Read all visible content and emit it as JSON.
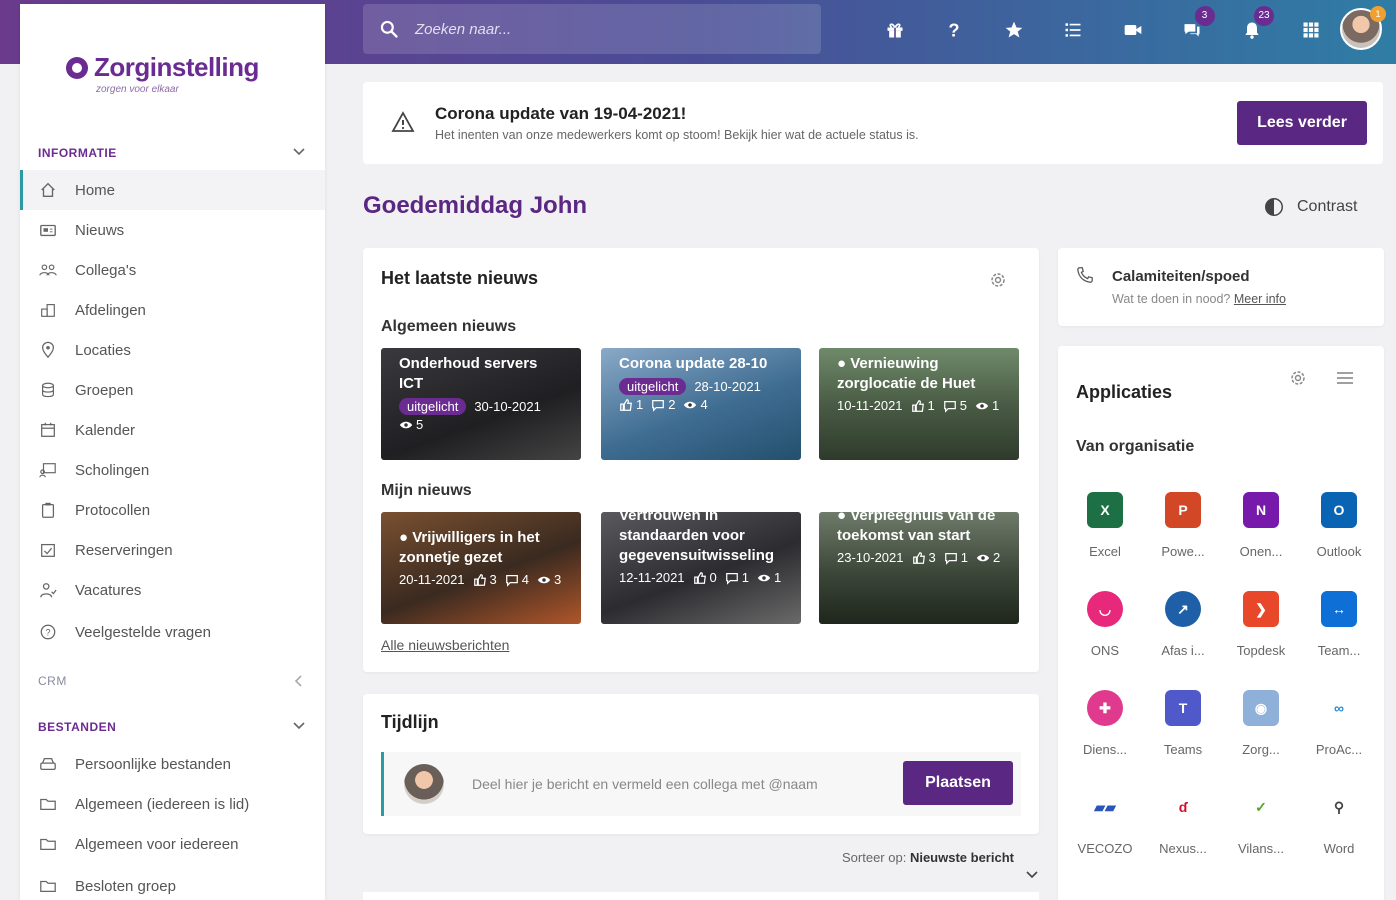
{
  "header": {
    "search_placeholder": "Zoeken naar...",
    "icons": [
      {
        "name": "gift-icon",
        "badge": ""
      },
      {
        "name": "help-icon",
        "badge": ""
      },
      {
        "name": "star-icon",
        "badge": ""
      },
      {
        "name": "list-icon",
        "badge": ""
      },
      {
        "name": "video-icon",
        "badge": ""
      },
      {
        "name": "chat-icon",
        "badge": "3"
      },
      {
        "name": "bell-icon",
        "badge": "23"
      },
      {
        "name": "grid-icon",
        "badge": ""
      }
    ],
    "avatar_badge": "1"
  },
  "sidebar": {
    "logo": {
      "name": "Zorginstelling",
      "tagline": "zorgen voor elkaar"
    },
    "sections": {
      "informatie": "INFORMATIE",
      "crm": "CRM",
      "bestanden": "BESTANDEN"
    },
    "informatie_items": [
      {
        "label": "Home",
        "icon": "home-icon",
        "active": true
      },
      {
        "label": "Nieuws",
        "icon": "news-icon"
      },
      {
        "label": "Collega's",
        "icon": "colleagues-icon"
      },
      {
        "label": "Afdelingen",
        "icon": "departments-icon"
      },
      {
        "label": "Locaties",
        "icon": "location-icon"
      },
      {
        "label": "Groepen",
        "icon": "groups-icon"
      },
      {
        "label": "Kalender",
        "icon": "calendar-icon"
      },
      {
        "label": "Scholingen",
        "icon": "training-icon"
      },
      {
        "label": "Protocollen",
        "icon": "clipboard-icon"
      },
      {
        "label": "Reserveringen",
        "icon": "reservation-icon"
      },
      {
        "label": "Vacatures",
        "icon": "vacancy-icon"
      },
      {
        "label": "Veelgestelde vragen",
        "icon": "faq-icon"
      }
    ],
    "bestanden_items": [
      {
        "label": "Persoonlijke bestanden",
        "icon": "drive-icon"
      },
      {
        "label": "Algemeen (iedereen is lid)",
        "icon": "folder-icon"
      },
      {
        "label": "Algemeen voor iedereen",
        "icon": "folder-icon"
      },
      {
        "label": "Besloten groep",
        "icon": "folder-icon"
      }
    ]
  },
  "banner": {
    "title": "Corona update van 19-04-2021!",
    "text": "Het inenten van onze medewerkers komt op stoom! Bekijk hier wat de actuele status is.",
    "button": "Lees verder"
  },
  "greeting": "Goedemiddag John",
  "contrast_label": "Contrast",
  "news": {
    "title": "Het laatste nieuws",
    "general_heading": "Algemeen nieuws",
    "mine_heading": "Mijn nieuws",
    "all_link": "Alle nieuwsberichten",
    "general": [
      {
        "title": "Onderhoud servers ICT",
        "tag": "uitgelicht",
        "date": "30-10-2021",
        "likes": "",
        "comments": "",
        "views": "5"
      },
      {
        "title": "Corona update 28-10",
        "tag": "uitgelicht",
        "date": "28-10-2021",
        "likes": "1",
        "comments": "2",
        "views": "4"
      },
      {
        "title": "Vernieuwing zorglocatie de Huet",
        "tag": "",
        "date": "10-11-2021",
        "likes": "1",
        "comments": "5",
        "views": "1"
      }
    ],
    "mine": [
      {
        "title": "Vrijwilligers in het zonnetje gezet",
        "tag": "",
        "date": "20-11-2021",
        "likes": "3",
        "comments": "4",
        "views": "3"
      },
      {
        "title": "Vertrouwen in standaarden voor gegevensuitwisseling",
        "tag": "",
        "date": "12-11-2021",
        "likes": "0",
        "comments": "1",
        "views": "1"
      },
      {
        "title": "Verpleeghuis van de toekomst van start",
        "tag": "",
        "date": "23-10-2021",
        "likes": "3",
        "comments": "1",
        "views": "2"
      }
    ]
  },
  "timeline": {
    "title": "Tijdlijn",
    "placeholder": "Deel hier je bericht en vermeld een collega met @naam",
    "button": "Plaatsen",
    "sort_prefix": "Sorteer op:",
    "sort_value": "Nieuwste bericht"
  },
  "emergency": {
    "title": "Calamiteiten/spoed",
    "text": "Wat te doen in nood?",
    "link": "Meer info"
  },
  "apps": {
    "title": "Applicaties",
    "subtitle": "Van organisatie",
    "items": [
      {
        "label": "Excel",
        "color": "#1d7044",
        "glyph": "X"
      },
      {
        "label": "Powe...",
        "color": "#d24726",
        "glyph": "P"
      },
      {
        "label": "Onen...",
        "color": "#7719aa",
        "glyph": "N"
      },
      {
        "label": "Outlook",
        "color": "#0a64b4",
        "glyph": "O"
      },
      {
        "label": "ONS",
        "color": "#e8287a",
        "glyph": "◡"
      },
      {
        "label": "Afas i...",
        "color": "#1e5fa8",
        "glyph": "↗"
      },
      {
        "label": "Topdesk",
        "color": "#e8472a",
        "glyph": "❯"
      },
      {
        "label": "Team...",
        "color": "#0e6fd6",
        "glyph": "↔"
      },
      {
        "label": "Diens...",
        "color": "#e03a8e",
        "glyph": "✚"
      },
      {
        "label": "Teams",
        "color": "#5059c9",
        "glyph": "T"
      },
      {
        "label": "Zorg...",
        "color": "#8fb0d9",
        "glyph": "◉"
      },
      {
        "label": "ProAc...",
        "color": "#ffffff",
        "glyph": "∞"
      },
      {
        "label": "VECOZO",
        "color": "#ffffff",
        "glyph": "▰▰"
      },
      {
        "label": "Nexus...",
        "color": "#ffffff",
        "glyph": "ɗ"
      },
      {
        "label": "Vilans...",
        "color": "#ffffff",
        "glyph": "✓"
      },
      {
        "label": "Word",
        "color": "#ffffff",
        "glyph": "⚲"
      }
    ]
  }
}
